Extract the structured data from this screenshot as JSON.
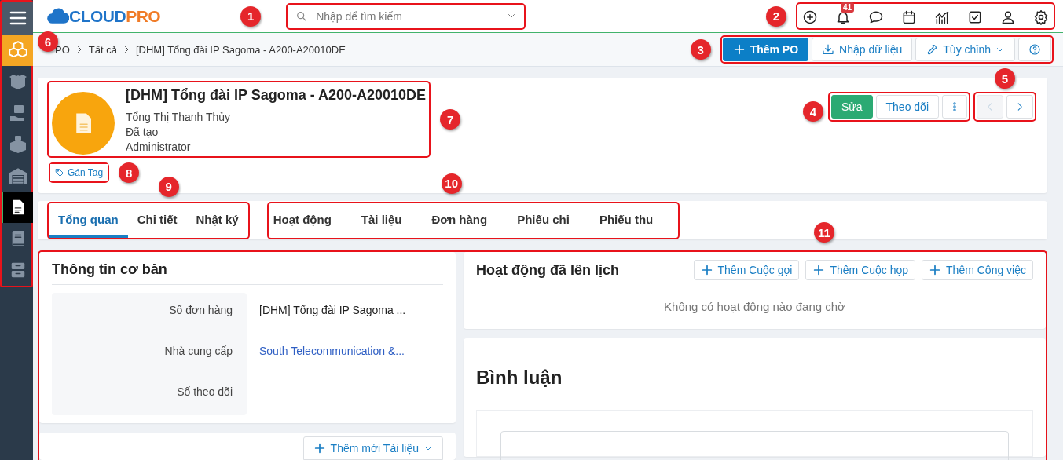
{
  "sidebar": {
    "callout": "6",
    "items": [
      {
        "kind": "menu",
        "selected": false,
        "highlighted": false
      },
      {
        "kind": "cubes",
        "selected": false,
        "highlighted": true
      },
      {
        "kind": "box",
        "selected": false,
        "highlighted": false
      },
      {
        "kind": "hand-box",
        "selected": false,
        "highlighted": false
      },
      {
        "kind": "boxes",
        "selected": false,
        "highlighted": false
      },
      {
        "kind": "warehouse",
        "selected": false,
        "highlighted": false
      },
      {
        "kind": "document",
        "selected": true,
        "highlighted": false
      },
      {
        "kind": "book",
        "selected": false,
        "highlighted": false
      },
      {
        "kind": "cabinet",
        "selected": false,
        "highlighted": false
      }
    ]
  },
  "header": {
    "logo": {
      "first": "CLOUD",
      "second": "PRO"
    },
    "search": {
      "placeholder": "Nhập để tìm kiếm",
      "callout": "1"
    },
    "toolbar": {
      "callout": "2",
      "icons": [
        {
          "kind": "add"
        },
        {
          "kind": "bell",
          "badge": "41"
        },
        {
          "kind": "chat"
        },
        {
          "kind": "calendar"
        },
        {
          "kind": "chart"
        },
        {
          "kind": "task"
        },
        {
          "kind": "user"
        },
        {
          "kind": "settings"
        }
      ]
    }
  },
  "breadcrumb": [
    "PO",
    "Tất cả",
    "[DHM] Tổng đài IP Sagoma - A200-A20010DE"
  ],
  "actions": {
    "callout": "3",
    "buttons": [
      {
        "kind": "primary",
        "label": "Thêm PO"
      },
      {
        "kind": "import",
        "label": "Nhập dữ liệu"
      },
      {
        "kind": "dropdown",
        "label": "Tùy chỉnh"
      },
      {
        "kind": "help"
      }
    ]
  },
  "record": {
    "callout": "7",
    "title": "[DHM] Tổng đài IP Sagoma - A200-A20010DE",
    "lines": [
      "Tổng Thị Thanh Thủy",
      "Đã tạo",
      "Administrator"
    ]
  },
  "tag_button": {
    "label": "Gán Tag",
    "callout": "8"
  },
  "record_actions": {
    "callout": "4",
    "buttons": [
      {
        "kind": "success",
        "label": "Sửa"
      },
      {
        "kind": "outline",
        "label": "Theo dõi"
      },
      {
        "kind": "more"
      }
    ]
  },
  "pager": {
    "callout": "5",
    "buttons": [
      {
        "kind": "prev",
        "disabled": true
      },
      {
        "kind": "next",
        "disabled": false
      }
    ]
  },
  "tabs_main": {
    "callout": "9",
    "tabs": [
      {
        "label": "Tổng quan",
        "selected": true
      },
      {
        "label": "Chi tiết",
        "selected": false
      },
      {
        "label": "Nhật ký",
        "selected": false
      }
    ]
  },
  "tabs_related": {
    "callout": "10",
    "tabs": [
      {
        "label": "Hoạt động",
        "selected": false
      },
      {
        "label": "Tài liệu",
        "selected": false
      },
      {
        "label": "Đơn hàng",
        "selected": false
      },
      {
        "label": "Phiếu chi",
        "selected": false
      },
      {
        "label": "Phiếu thu",
        "selected": false
      }
    ]
  },
  "content": {
    "callout": "11",
    "basic_info": {
      "title": "Thông tin cơ bản",
      "fields": [
        {
          "label": "Số đơn hàng",
          "value": "[DHM] Tổng đài IP Sagoma ...",
          "kind": "text"
        },
        {
          "label": "Nhà cung cấp",
          "value": "South Telecommunication &...",
          "kind": "link"
        },
        {
          "label": "Số theo dõi"
        }
      ]
    },
    "documents": {
      "button": "Thêm mới Tài liệu"
    },
    "activities": {
      "title": "Hoạt động đã lên lịch",
      "buttons": [
        "Thêm Cuộc gọi",
        "Thêm Cuộc họp",
        "Thêm Công việc"
      ],
      "empty": "Không có hoạt động nào đang chờ"
    },
    "comments": {
      "title": "Bình luận"
    }
  }
}
